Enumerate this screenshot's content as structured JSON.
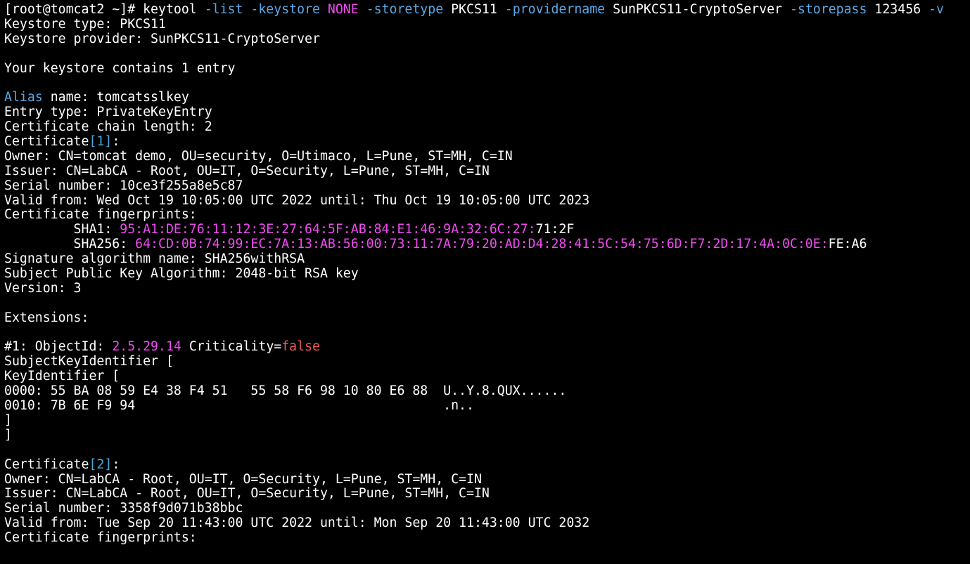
{
  "colors": {
    "background": "#000000",
    "default": "#ffffff",
    "option": "#5aa8e6",
    "keyword": "#f04bf0",
    "hex": "#f04bf0",
    "false": "#f05a5a",
    "index": "#4aa6d6"
  },
  "terminal": {
    "lines": [
      [
        {
          "t": "[root@tomcat2 ~]# keytool "
        },
        {
          "t": "-list ",
          "c": "option"
        },
        {
          "t": "-keystore ",
          "c": "option"
        },
        {
          "t": "NONE ",
          "c": "keyword"
        },
        {
          "t": "-storetype ",
          "c": "option"
        },
        {
          "t": "PKCS11 "
        },
        {
          "t": "-providername ",
          "c": "option"
        },
        {
          "t": "SunPKCS11-CryptoServer "
        },
        {
          "t": "-storepass ",
          "c": "option"
        },
        {
          "t": "123456 "
        },
        {
          "t": "-v",
          "c": "option"
        }
      ],
      [
        {
          "t": "Keystore type: PKCS11"
        }
      ],
      [
        {
          "t": "Keystore provider: SunPKCS11-CryptoServer"
        }
      ],
      [],
      [
        {
          "t": "Your keystore contains 1 entry"
        }
      ],
      [],
      [
        {
          "t": "Alias",
          "c": "option"
        },
        {
          "t": " name: tomcatsslkey"
        }
      ],
      [
        {
          "t": "Entry type: PrivateKeyEntry"
        }
      ],
      [
        {
          "t": "Certificate chain length: 2"
        }
      ],
      [
        {
          "t": "Certificate"
        },
        {
          "t": "[1]",
          "c": "index"
        },
        {
          "t": ":"
        }
      ],
      [
        {
          "t": "Owner: CN=tomcat demo, OU=security, O=Utimaco, L=Pune, ST=MH, C=IN"
        }
      ],
      [
        {
          "t": "Issuer: CN=LabCA - Root, OU=IT, O=Security, L=Pune, ST=MH, C=IN"
        }
      ],
      [
        {
          "t": "Serial number: 10ce3f255a8e5c87"
        }
      ],
      [
        {
          "t": "Valid from: Wed Oct 19 10:05:00 UTC 2022 until: Thu Oct 19 10:05:00 UTC 2023"
        }
      ],
      [
        {
          "t": "Certificate fingerprints:"
        }
      ],
      [
        {
          "t": "         SHA1: "
        },
        {
          "t": "95:A1:DE:76:11:12:3E:27:64:5F:AB:84:E1:46:9A:32:6C:27:",
          "c": "hex"
        },
        {
          "t": "71:2F"
        }
      ],
      [
        {
          "t": "         SHA256: "
        },
        {
          "t": "64:CD:0B:74:99:EC:7A:13:AB:56:00:73:11:7A:79:20:AD:D4:28:41:5C:54:75:6D:F7:2D:17:4A:0C:0E:",
          "c": "hex"
        },
        {
          "t": "FE:A6"
        }
      ],
      [
        {
          "t": "Signature algorithm name: SHA256withRSA"
        }
      ],
      [
        {
          "t": "Subject Public Key Algorithm: 2048-bit RSA key"
        }
      ],
      [
        {
          "t": "Version: 3"
        }
      ],
      [],
      [
        {
          "t": "Extensions:"
        }
      ],
      [],
      [
        {
          "t": "#1: ObjectId: "
        },
        {
          "t": "2.5.29.14",
          "c": "keyword"
        },
        {
          "t": " Criticality="
        },
        {
          "t": "false",
          "c": "false"
        }
      ],
      [
        {
          "t": "SubjectKeyIdentifier ["
        }
      ],
      [
        {
          "t": "KeyIdentifier ["
        }
      ],
      [
        {
          "t": "0000: 55 BA 08 59 E4 38 F4 51   55 58 F6 98 10 80 E6 88  U..Y.8.QUX......"
        }
      ],
      [
        {
          "t": "0010: 7B 6E F9 94                                        .n.."
        }
      ],
      [
        {
          "t": "]"
        }
      ],
      [
        {
          "t": "]"
        }
      ],
      [],
      [
        {
          "t": "Certificate"
        },
        {
          "t": "[2]",
          "c": "index"
        },
        {
          "t": ":"
        }
      ],
      [
        {
          "t": "Owner: CN=LabCA - Root, OU=IT, O=Security, L=Pune, ST=MH, C=IN"
        }
      ],
      [
        {
          "t": "Issuer: CN=LabCA - Root, OU=IT, O=Security, L=Pune, ST=MH, C=IN"
        }
      ],
      [
        {
          "t": "Serial number: 3358f9d071b38bbc"
        }
      ],
      [
        {
          "t": "Valid from: Tue Sep 20 11:43:00 UTC 2022 until: Mon Sep 20 11:43:00 UTC 2032"
        }
      ],
      [
        {
          "t": "Certificate fingerprints:"
        }
      ]
    ]
  }
}
